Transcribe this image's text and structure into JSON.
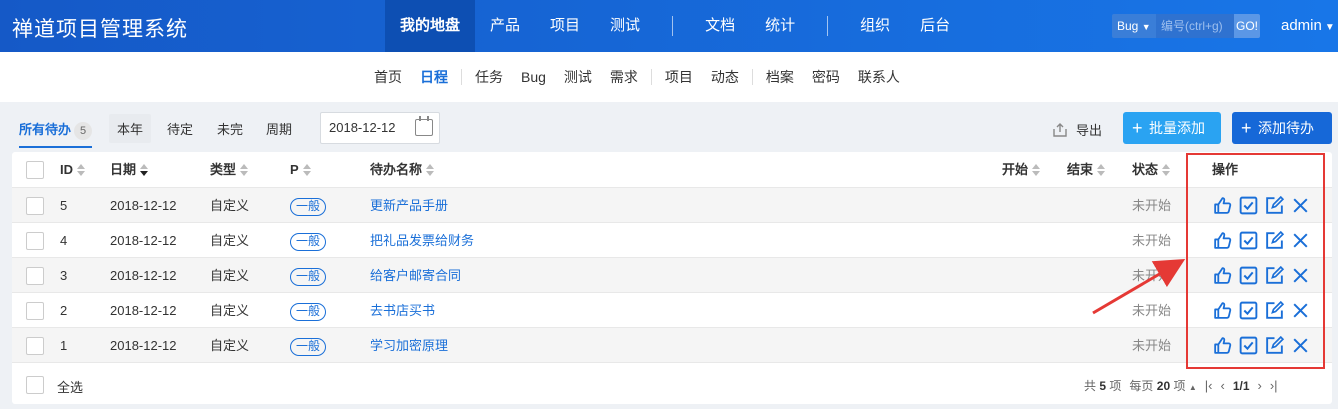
{
  "header": {
    "brand": "禅道项目管理系统",
    "nav": [
      "我的地盘",
      "产品",
      "项目",
      "测试",
      "文档",
      "统计",
      "组织",
      "后台"
    ],
    "search": {
      "type": "Bug",
      "placeholder": "编号(ctrl+g)",
      "go": "GO!"
    },
    "user": "admin"
  },
  "subnav": [
    "首页",
    "日程",
    "任务",
    "Bug",
    "测试",
    "需求",
    "项目",
    "动态",
    "档案",
    "密码",
    "联系人"
  ],
  "toolbar": {
    "tab_all": "所有待办",
    "tab_all_count": "5",
    "tabs": [
      "本年",
      "待定",
      "未完",
      "周期"
    ],
    "date": "2018-12-12",
    "export": "导出",
    "batch_add": "批量添加",
    "add": "添加待办"
  },
  "table": {
    "columns": {
      "id": "ID",
      "date": "日期",
      "type": "类型",
      "pri": "P",
      "name": "待办名称",
      "begin": "开始",
      "end": "结束",
      "status": "状态",
      "actions": "操作"
    },
    "rows": [
      {
        "id": "5",
        "date": "2018-12-12",
        "type": "自定义",
        "pri": "一般",
        "name": "更新产品手册",
        "status": "未开始"
      },
      {
        "id": "4",
        "date": "2018-12-12",
        "type": "自定义",
        "pri": "一般",
        "name": "把礼品发票给财务",
        "status": "未开始"
      },
      {
        "id": "3",
        "date": "2018-12-12",
        "type": "自定义",
        "pri": "一般",
        "name": "给客户邮寄合同",
        "status": "未开始"
      },
      {
        "id": "2",
        "date": "2018-12-12",
        "type": "自定义",
        "pri": "一般",
        "name": "去书店买书",
        "status": "未开始"
      },
      {
        "id": "1",
        "date": "2018-12-12",
        "type": "自定义",
        "pri": "一般",
        "name": "学习加密原理",
        "status": "未开始"
      }
    ]
  },
  "footer": {
    "select_all": "全选",
    "total_prefix": "共",
    "total": "5",
    "total_suffix": "项",
    "per_page_prefix": "每页",
    "per_page": "20",
    "per_page_suffix": "项",
    "page": "1/1"
  },
  "colors": {
    "accent": "#1a6fd8",
    "annotation": "#e53935"
  }
}
